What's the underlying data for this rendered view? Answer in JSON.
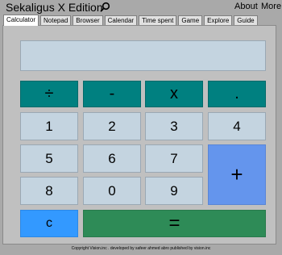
{
  "app": {
    "title": "Sekaligus X Edition"
  },
  "top_links": {
    "about": "About",
    "more": "More"
  },
  "tabs": [
    {
      "label": "Calculator",
      "active": true
    },
    {
      "label": "Notepad"
    },
    {
      "label": "Browser"
    },
    {
      "label": "Calendar"
    },
    {
      "label": "Time spent"
    },
    {
      "label": "Game"
    },
    {
      "label": "Explore"
    },
    {
      "label": "Guide"
    }
  ],
  "calculator": {
    "display_value": "",
    "keys": {
      "divide": "÷",
      "minus": "-",
      "multiply": "x",
      "dot": ".",
      "one": "1",
      "two": "2",
      "three": "3",
      "four": "4",
      "five": "5",
      "six": "6",
      "seven": "7",
      "plus": "+",
      "eight": "8",
      "zero": "0",
      "nine": "9",
      "clear": "c",
      "equals": "="
    }
  },
  "footer": {
    "copyright": "Copyright Vision.inc . developed by safeer ahmed abro published by vision.inc"
  },
  "colors": {
    "background": "#a9a9a9",
    "panel": "#c0c0c0",
    "display": "#c4d4e0",
    "operator": "#008080",
    "plus": "#6495ed",
    "clear": "#3399ff",
    "equals": "#2e8b57"
  }
}
